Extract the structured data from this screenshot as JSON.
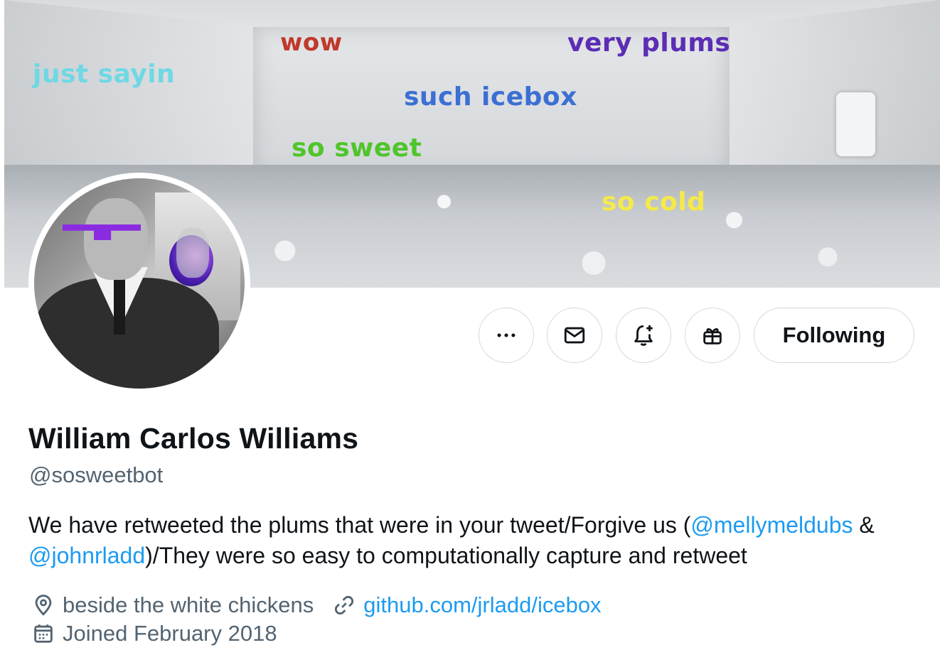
{
  "banner": {
    "captions": {
      "wow": "wow",
      "very_plums": "very plums",
      "such_icebox": "such icebox",
      "just_sayin": "just sayin",
      "so_sweet": "so sweet",
      "so_cold": "so cold"
    }
  },
  "avatar": {
    "icon": "avatar-photo"
  },
  "actions": {
    "more_icon": "ellipsis-icon",
    "message_icon": "envelope-icon",
    "notify_icon": "bell-plus-icon",
    "gift_icon": "gift-icon",
    "following_label": "Following"
  },
  "profile": {
    "name": "William Carlos Williams",
    "handle": "@sosweetbot",
    "bio": {
      "part1": "We have retweeted the plums that were in your tweet/Forgive us (",
      "mention1": "@mellymeldubs",
      "part2": " & ",
      "mention2": "@johnrladd",
      "part3": ")/They were so easy to computationally capture and retweet"
    },
    "location": "beside the white chickens",
    "website": "github.com/jrladd/icebox",
    "joined": "Joined February 2018"
  },
  "colors": {
    "link": "#1d9bf0",
    "secondary_text": "#536471",
    "border": "#cfd9de"
  }
}
